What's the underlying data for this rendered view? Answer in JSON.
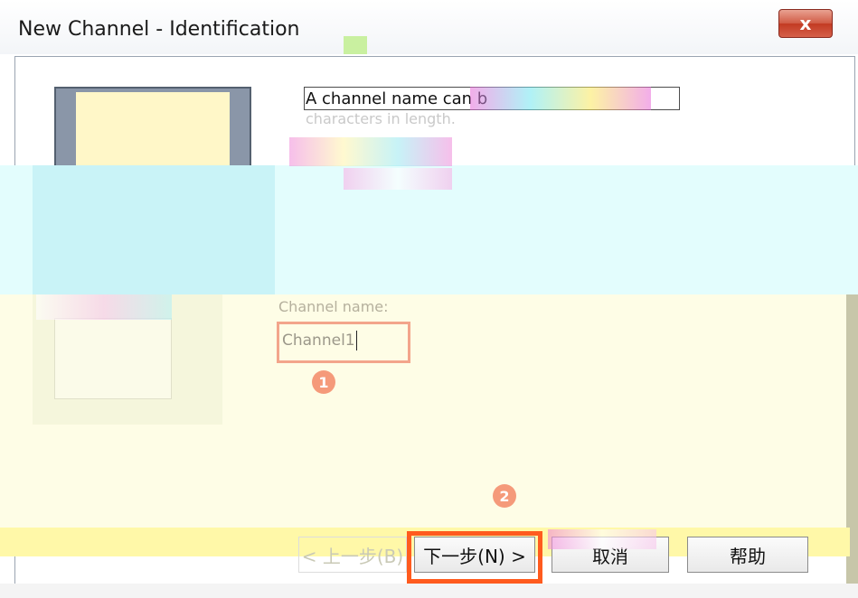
{
  "window": {
    "title": "New Channel - Identification",
    "close_label": "x"
  },
  "description": {
    "line1": "A channel name can b",
    "line2": "characters in length."
  },
  "channel_name": {
    "label": "Channel name:",
    "value": "Channel1"
  },
  "markers": {
    "first": "1",
    "second": "2"
  },
  "buttons": {
    "back": "< 上一步(B)",
    "next": "下一步(N) >",
    "cancel": "取消",
    "help": "帮助"
  },
  "colors": {
    "highlight": "#ff5b1e",
    "marker": "#f59a7a",
    "close_button": "#c23a22"
  }
}
